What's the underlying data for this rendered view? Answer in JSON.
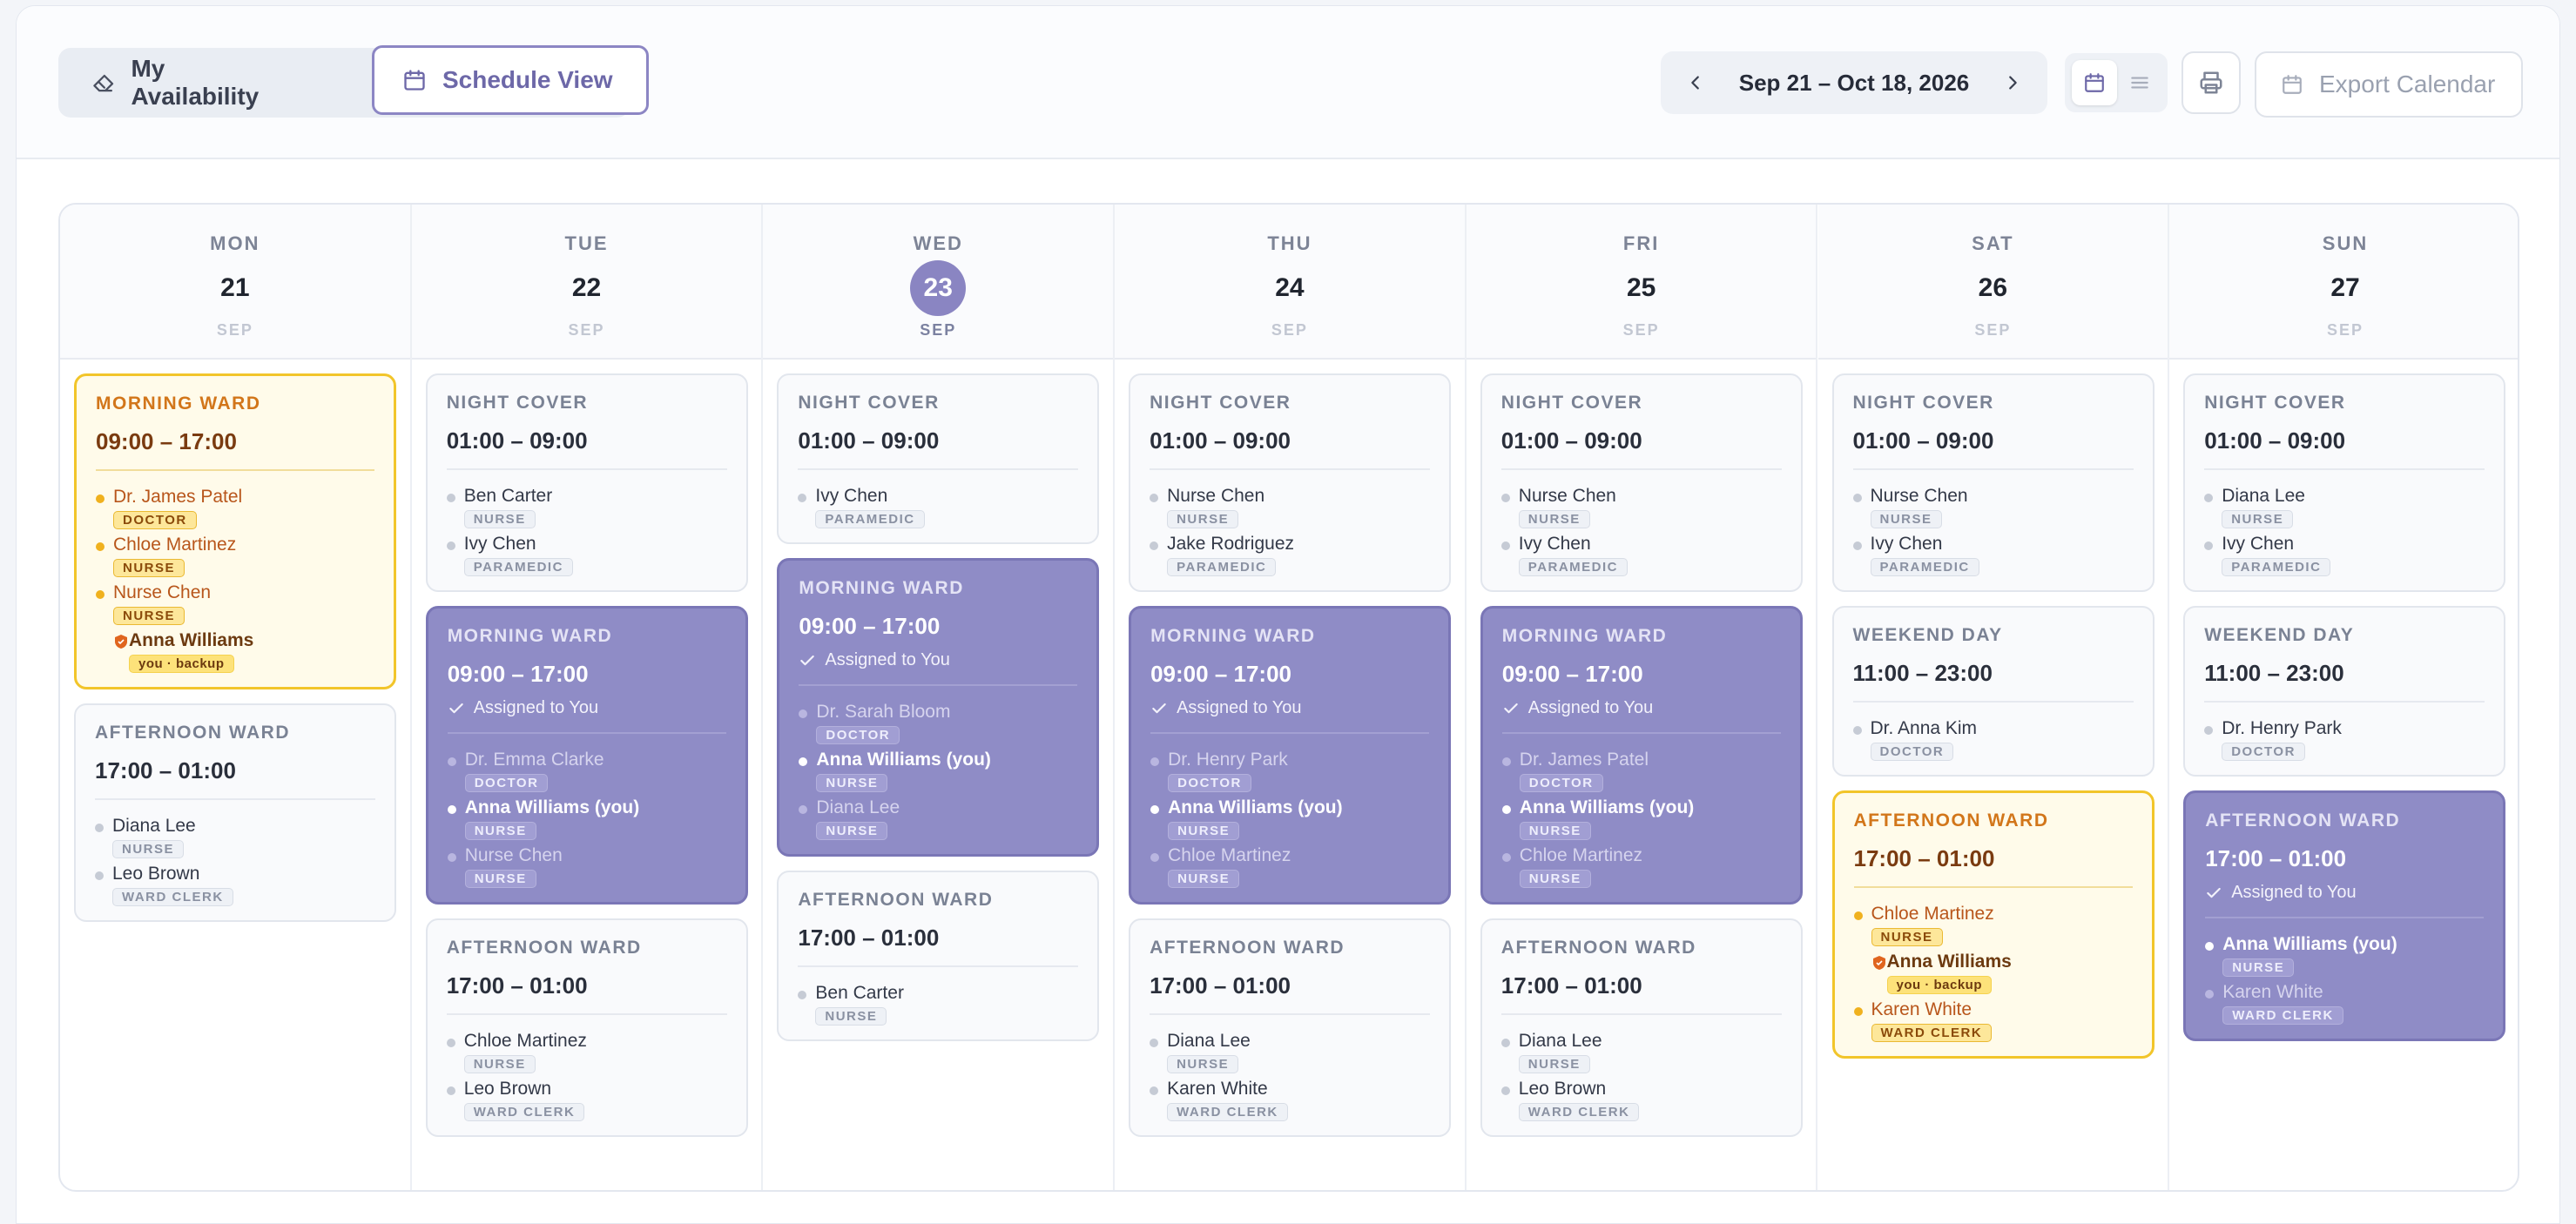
{
  "toolbar": {
    "my_availability": "My Availability",
    "schedule_view": "Schedule View",
    "date_range": "Sep 21 – Oct 18, 2026",
    "export_label": "Export Calendar",
    "view_modes": [
      "calendar",
      "list"
    ],
    "active_view": "calendar"
  },
  "colors": {
    "accent": "#8f8cc6",
    "backup": "#f2c52a",
    "today": "#8a85c2"
  },
  "days": [
    {
      "dow": "MON",
      "num": "21",
      "mon": "SEP",
      "today": false,
      "shifts": [
        {
          "title": "MORNING WARD",
          "time": "09:00 – 17:00",
          "kind": "backup",
          "staff": [
            {
              "name": "Dr. James Patel",
              "role": "DOCTOR"
            },
            {
              "name": "Chloe Martinez",
              "role": "NURSE"
            },
            {
              "name": "Nurse Chen",
              "role": "NURSE"
            },
            {
              "name": "Anna Williams",
              "role": "you · backup",
              "backup": true
            }
          ]
        },
        {
          "title": "AFTERNOON WARD",
          "time": "17:00 – 01:00",
          "kind": "normal",
          "staff": [
            {
              "name": "Diana Lee",
              "role": "NURSE"
            },
            {
              "name": "Leo Brown",
              "role": "WARD CLERK"
            }
          ]
        }
      ]
    },
    {
      "dow": "TUE",
      "num": "22",
      "mon": "SEP",
      "today": false,
      "shifts": [
        {
          "title": "NIGHT COVER",
          "time": "01:00 – 09:00",
          "kind": "normal",
          "staff": [
            {
              "name": "Ben Carter",
              "role": "NURSE"
            },
            {
              "name": "Ivy Chen",
              "role": "PARAMEDIC"
            }
          ]
        },
        {
          "title": "MORNING WARD",
          "time": "09:00 – 17:00",
          "kind": "assigned",
          "assigned_label": "Assigned to You",
          "staff": [
            {
              "name": "Dr. Emma Clarke",
              "role": "DOCTOR"
            },
            {
              "name": "Anna Williams (you)",
              "role": "NURSE",
              "me": true
            },
            {
              "name": "Nurse Chen",
              "role": "NURSE"
            }
          ]
        },
        {
          "title": "AFTERNOON WARD",
          "time": "17:00 – 01:00",
          "kind": "normal",
          "staff": [
            {
              "name": "Chloe Martinez",
              "role": "NURSE"
            },
            {
              "name": "Leo Brown",
              "role": "WARD CLERK"
            }
          ]
        }
      ]
    },
    {
      "dow": "WED",
      "num": "23",
      "mon": "SEP",
      "today": true,
      "shifts": [
        {
          "title": "NIGHT COVER",
          "time": "01:00 – 09:00",
          "kind": "normal",
          "staff": [
            {
              "name": "Ivy Chen",
              "role": "PARAMEDIC"
            }
          ]
        },
        {
          "title": "MORNING WARD",
          "time": "09:00 – 17:00",
          "kind": "assigned",
          "assigned_label": "Assigned to You",
          "staff": [
            {
              "name": "Dr. Sarah Bloom",
              "role": "DOCTOR"
            },
            {
              "name": "Anna Williams (you)",
              "role": "NURSE",
              "me": true
            },
            {
              "name": "Diana Lee",
              "role": "NURSE"
            }
          ]
        },
        {
          "title": "AFTERNOON WARD",
          "time": "17:00 – 01:00",
          "kind": "normal",
          "staff": [
            {
              "name": "Ben Carter",
              "role": "NURSE"
            }
          ]
        }
      ]
    },
    {
      "dow": "THU",
      "num": "24",
      "mon": "SEP",
      "today": false,
      "shifts": [
        {
          "title": "NIGHT COVER",
          "time": "01:00 – 09:00",
          "kind": "normal",
          "staff": [
            {
              "name": "Nurse Chen",
              "role": "NURSE"
            },
            {
              "name": "Jake Rodriguez",
              "role": "PARAMEDIC"
            }
          ]
        },
        {
          "title": "MORNING WARD",
          "time": "09:00 – 17:00",
          "kind": "assigned",
          "assigned_label": "Assigned to You",
          "staff": [
            {
              "name": "Dr. Henry Park",
              "role": "DOCTOR"
            },
            {
              "name": "Anna Williams (you)",
              "role": "NURSE",
              "me": true
            },
            {
              "name": "Chloe Martinez",
              "role": "NURSE"
            }
          ]
        },
        {
          "title": "AFTERNOON WARD",
          "time": "17:00 – 01:00",
          "kind": "normal",
          "staff": [
            {
              "name": "Diana Lee",
              "role": "NURSE"
            },
            {
              "name": "Karen White",
              "role": "WARD CLERK"
            }
          ]
        }
      ]
    },
    {
      "dow": "FRI",
      "num": "25",
      "mon": "SEP",
      "today": false,
      "shifts": [
        {
          "title": "NIGHT COVER",
          "time": "01:00 – 09:00",
          "kind": "normal",
          "staff": [
            {
              "name": "Nurse Chen",
              "role": "NURSE"
            },
            {
              "name": "Ivy Chen",
              "role": "PARAMEDIC"
            }
          ]
        },
        {
          "title": "MORNING WARD",
          "time": "09:00 – 17:00",
          "kind": "assigned",
          "assigned_label": "Assigned to You",
          "staff": [
            {
              "name": "Dr. James Patel",
              "role": "DOCTOR"
            },
            {
              "name": "Anna Williams (you)",
              "role": "NURSE",
              "me": true
            },
            {
              "name": "Chloe Martinez",
              "role": "NURSE"
            }
          ]
        },
        {
          "title": "AFTERNOON WARD",
          "time": "17:00 – 01:00",
          "kind": "normal",
          "staff": [
            {
              "name": "Diana Lee",
              "role": "NURSE"
            },
            {
              "name": "Leo Brown",
              "role": "WARD CLERK"
            }
          ]
        }
      ]
    },
    {
      "dow": "SAT",
      "num": "26",
      "mon": "SEP",
      "today": false,
      "shifts": [
        {
          "title": "NIGHT COVER",
          "time": "01:00 – 09:00",
          "kind": "normal",
          "staff": [
            {
              "name": "Nurse Chen",
              "role": "NURSE"
            },
            {
              "name": "Ivy Chen",
              "role": "PARAMEDIC"
            }
          ]
        },
        {
          "title": "WEEKEND DAY",
          "time": "11:00 – 23:00",
          "kind": "normal",
          "staff": [
            {
              "name": "Dr. Anna Kim",
              "role": "DOCTOR"
            }
          ]
        },
        {
          "title": "AFTERNOON WARD",
          "time": "17:00 – 01:00",
          "kind": "backup",
          "staff": [
            {
              "name": "Chloe Martinez",
              "role": "NURSE"
            },
            {
              "name": "Anna Williams",
              "role": "you · backup",
              "backup": true
            },
            {
              "name": "Karen White",
              "role": "WARD CLERK"
            }
          ]
        }
      ]
    },
    {
      "dow": "SUN",
      "num": "27",
      "mon": "SEP",
      "today": false,
      "shifts": [
        {
          "title": "NIGHT COVER",
          "time": "01:00 – 09:00",
          "kind": "normal",
          "staff": [
            {
              "name": "Diana Lee",
              "role": "NURSE"
            },
            {
              "name": "Ivy Chen",
              "role": "PARAMEDIC"
            }
          ]
        },
        {
          "title": "WEEKEND DAY",
          "time": "11:00 – 23:00",
          "kind": "normal",
          "staff": [
            {
              "name": "Dr. Henry Park",
              "role": "DOCTOR"
            }
          ]
        },
        {
          "title": "AFTERNOON WARD",
          "time": "17:00 – 01:00",
          "kind": "assigned",
          "assigned_label": "Assigned to You",
          "staff": [
            {
              "name": "Anna Williams (you)",
              "role": "NURSE",
              "me": true
            },
            {
              "name": "Karen White",
              "role": "WARD CLERK"
            }
          ]
        }
      ]
    }
  ]
}
